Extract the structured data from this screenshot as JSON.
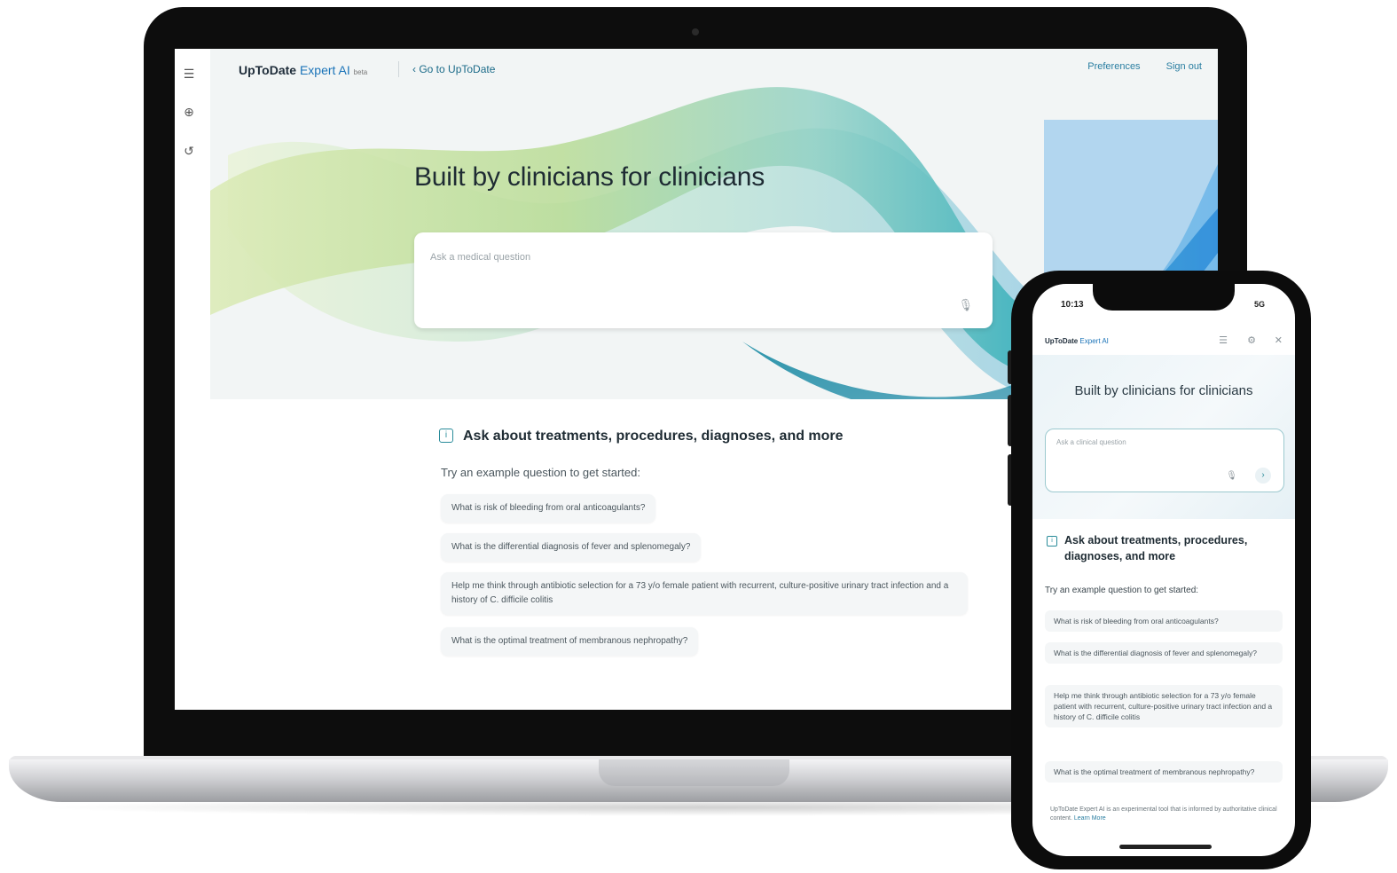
{
  "laptop": {
    "brand": "UpToDate",
    "brand_ai": "Expert AI",
    "brand_beta": "beta",
    "back_link": "Go to UpToDate",
    "nav": [
      "Preferences",
      "Sign out"
    ],
    "title": "Built by clinicians for clinicians",
    "ask_placeholder": "Ask a medical question",
    "ask_about": "Ask about treatments, procedures, diagnoses, and more",
    "try_text": "Try an example question to get started:",
    "example_questions": [
      "What is risk of bleeding from oral anticoagulants?",
      "What is the differential diagnosis of fever and splenomegaly?",
      "Help me think through antibiotic selection for a 73 y/o female patient with recurrent, culture-positive urinary tract infection and a history of C. difficile colitis",
      "What is the optimal treatment of membranous nephropathy?"
    ]
  },
  "phone": {
    "time": "10:13",
    "status": "5G",
    "brand": "UpToDate",
    "brand_ai": "Expert AI",
    "title": "Built by clinicians for clinicians",
    "ask_placeholder": "Ask a clinical question",
    "ask_about": "Ask about treatments, procedures, diagnoses, and more",
    "try_text": "Try an example question to get started:",
    "example_questions": [
      "What is risk of bleeding from oral anticoagulants?",
      "What is the differential diagnosis of fever and splenomegaly?",
      "Help me think through antibiotic selection for a 73 y/o female patient with recurrent, culture-positive urinary tract infection and a history of C. difficile colitis",
      "What is the optimal treatment of membranous nephropathy?"
    ],
    "footer": "UpToDate Expert AI is an experimental tool that is informed by authoritative clinical content.",
    "footer_link": "Learn More"
  },
  "colors": {
    "accent": "#1a73b8",
    "teal": "#2a8c9a",
    "ribbon_green": "#b8d98a",
    "ribbon_teal": "#3fb3b8",
    "ribbon_blue": "#2e8fd6"
  }
}
